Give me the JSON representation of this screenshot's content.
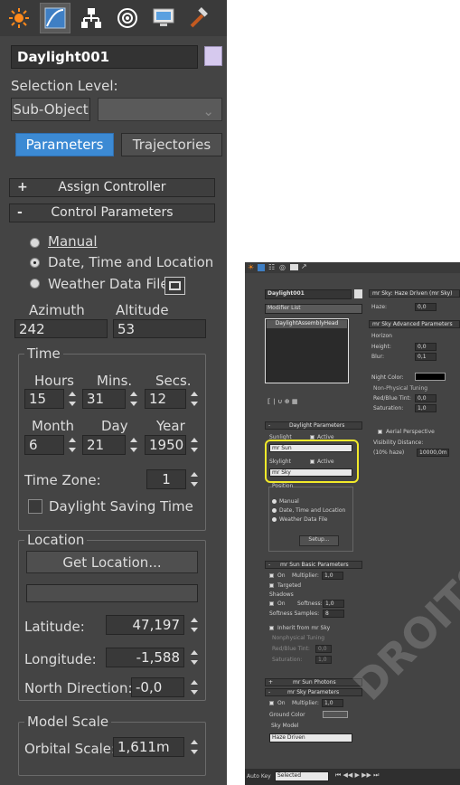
{
  "left": {
    "tabs": [
      {
        "icon": "sun-create-icon"
      },
      {
        "icon": "modify-icon"
      },
      {
        "icon": "hierarchy-icon"
      },
      {
        "icon": "motion-icon"
      },
      {
        "icon": "display-icon"
      },
      {
        "icon": "utilities-hammer-icon"
      }
    ],
    "object_name": "Daylight001",
    "object_color": "#d6c9ee",
    "selection_level_label": "Selection Level:",
    "sub_object_label": "Sub-Object",
    "parameters_label": "Parameters",
    "trajectories_label": "Trajectories",
    "assign_controller": {
      "sign": "+",
      "title": "Assign Controller"
    },
    "control_parameters": {
      "sign": "-",
      "title": "Control Parameters"
    },
    "radio_manual": "Manual",
    "radio_date": "Date, Time and Location",
    "radio_weather": "Weather Data File",
    "azimuth_label": "Azimuth",
    "altitude_label": "Altitude",
    "azimuth_value": "242",
    "altitude_value": "53",
    "time": {
      "title": "Time",
      "hours_label": "Hours",
      "mins_label": "Mins.",
      "secs_label": "Secs.",
      "hours": "15",
      "mins": "31",
      "secs": "12",
      "month_label": "Month",
      "day_label": "Day",
      "year_label": "Year",
      "month": "6",
      "day": "21",
      "year": "1950",
      "timezone_label": "Time Zone:",
      "timezone": "1",
      "dst_label": "Daylight Saving Time"
    },
    "location": {
      "title": "Location",
      "get_location": "Get Location...",
      "latitude_label": "Latitude:",
      "latitude": "47,197",
      "longitude_label": "Longitude:",
      "longitude": "-1,588",
      "north_label": "North Direction:",
      "north": "-0,0"
    },
    "model_scale": {
      "title": "Model Scale",
      "orbital_label": "Orbital Scale:",
      "orbital": "1,611m"
    }
  },
  "right": {
    "object_name": "Daylight001",
    "modifier_list": "Modifier List",
    "stack_item": "DaylightAssemblyHead",
    "daylight_params_title": "Daylight Parameters",
    "sunlight_label": "Sunlight",
    "active_label": "Active",
    "sun_select": "mr Sun",
    "skylight_label": "Skylight",
    "sky_select": "mr Sky",
    "position_label": "Position",
    "manual": "Manual",
    "date_time": "Date, Time and Location",
    "weather": "Weather Data File",
    "setup": "Setup...",
    "sun_basic_title": "mr Sun Basic Parameters",
    "on_label": "On",
    "multiplier_label": "Multiplier:",
    "multiplier": "1,0",
    "targeted": "Targeted",
    "shadows_label": "Shadows",
    "softness_label": "Softness:",
    "softness": "1,0",
    "softness_samples_label": "Softness Samples:",
    "softness_samples": "8",
    "inherit_label": "Inherit from mr Sky",
    "nonphys_label": "Nonphysical Tuning",
    "redblue_label": "Red/Blue Tint:",
    "redblue": "0,0",
    "saturation_label": "Saturation:",
    "saturation": "1,0",
    "sun_photons_title": "mr Sun Photons",
    "sky_params_title": "mr Sky Parameters",
    "sky_multiplier": "1,0",
    "ground_color_label": "Ground Color",
    "sky_model_label": "Sky Model",
    "sky_model": "Haze Driven",
    "haze_title": "mr Sky: Haze Driven (mr Sky)",
    "haze_label": "Haze:",
    "haze": "0,0",
    "advanced_title": "mr Sky Advanced Parameters",
    "horizon_label": "Horizon",
    "height_label": "Height:",
    "height": "0,0",
    "blur_label": "Blur:",
    "blur": "0,1",
    "night_color_label": "Night Color:",
    "nonphys2_label": "Non-Physical Tuning",
    "redblue2_label": "Red/Blue Tint:",
    "redblue2": "0,0",
    "saturation2_label": "Saturation:",
    "saturation2": "1,0",
    "aerial_label": "Aerial Perspective",
    "visibility_label": "Visibility Distance:",
    "visibility_hint": "(10% haze)",
    "visibility": "10000,0m",
    "status_autokey": "Auto Key",
    "status_selected": "Selected",
    "highlight_color": "#f2ea2a"
  }
}
